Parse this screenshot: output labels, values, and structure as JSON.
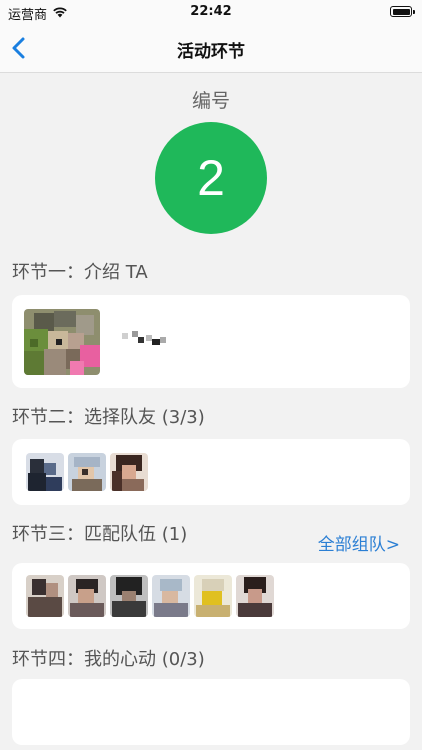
{
  "status_bar": {
    "carrier": "运营商",
    "time": "22:42"
  },
  "nav": {
    "title": "活动环节"
  },
  "number": {
    "label": "编号",
    "value": "2"
  },
  "sections": {
    "intro": "环节一：介绍 TA",
    "choose": "环节二：选择队友 (3/3)",
    "match": "环节三：匹配队伍 (1)",
    "heart": "环节四：我的心动 (0/3)"
  },
  "links": {
    "all_teams": "全部组队>"
  },
  "colors": {
    "accent_green": "#1fb85a",
    "link_blue": "#2b7fd4"
  }
}
